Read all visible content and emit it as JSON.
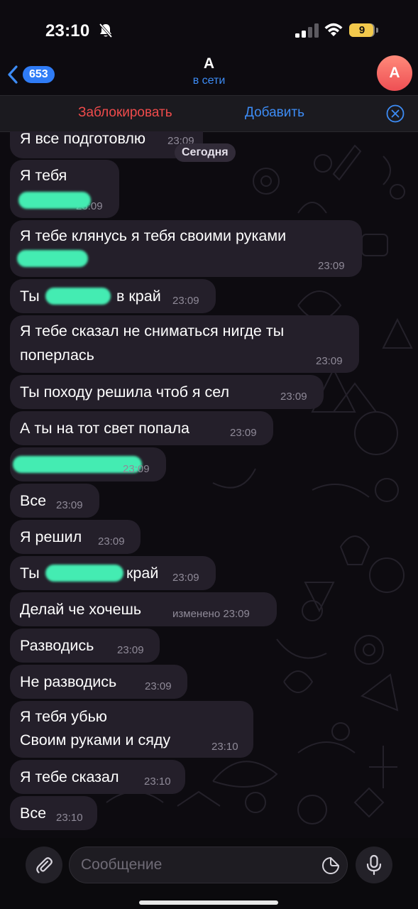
{
  "status_bar": {
    "time": "23:10",
    "battery": "9"
  },
  "header": {
    "back_count": "653",
    "contact_name": "А",
    "contact_status": "в сети",
    "avatar_letter": "А"
  },
  "actions": {
    "block_label": "Заблокировать",
    "add_label": "Добавить"
  },
  "date_label": "Сегодня",
  "messages": [
    {
      "text": "Я все подготовлю",
      "time": "23:09"
    },
    {
      "text": "Я тебя",
      "time": "23:09"
    },
    {
      "text": "Я тебе клянусь я тебя своими руками",
      "time": "23:09"
    },
    {
      "text_start": "Ты",
      "text_end": "в край",
      "time": "23:09"
    },
    {
      "line1": "Я тебе сказал не сниматься нигде ты",
      "line2": "поперлась",
      "time": "23:09"
    },
    {
      "text": "Ты походу решила чтоб я сел",
      "time": "23:09"
    },
    {
      "text": "А ты на тот свет попала",
      "time": "23:09"
    },
    {
      "time": "23:09"
    },
    {
      "text": "Все",
      "time": "23:09"
    },
    {
      "text": "Я решил",
      "time": "23:09"
    },
    {
      "text_start": "Ты",
      "text_end": "край",
      "time": "23:09"
    },
    {
      "text": "Делай че хочешь",
      "time": "изменено 23:09"
    },
    {
      "text": "Разводись",
      "time": "23:09"
    },
    {
      "text": "Не разводись",
      "time": "23:09"
    },
    {
      "line1": "Я тебя убью",
      "line2": "Своим руками и сяду",
      "time": "23:10"
    },
    {
      "text": "Я тебе сказал",
      "time": "23:10"
    },
    {
      "text": "Все",
      "time": "23:10"
    }
  ],
  "input": {
    "placeholder": "Сообщение"
  },
  "icons": {
    "back": "chevron-left-icon",
    "mute": "bell-slash-icon",
    "close": "close-circle-icon",
    "attach": "paperclip-icon",
    "sticker": "sticker-icon",
    "mic": "microphone-icon"
  },
  "colors": {
    "accent": "#3d8cf5",
    "danger": "#ef4b4b",
    "bubble": "#241f2a",
    "redaction": "#44ecb2"
  }
}
